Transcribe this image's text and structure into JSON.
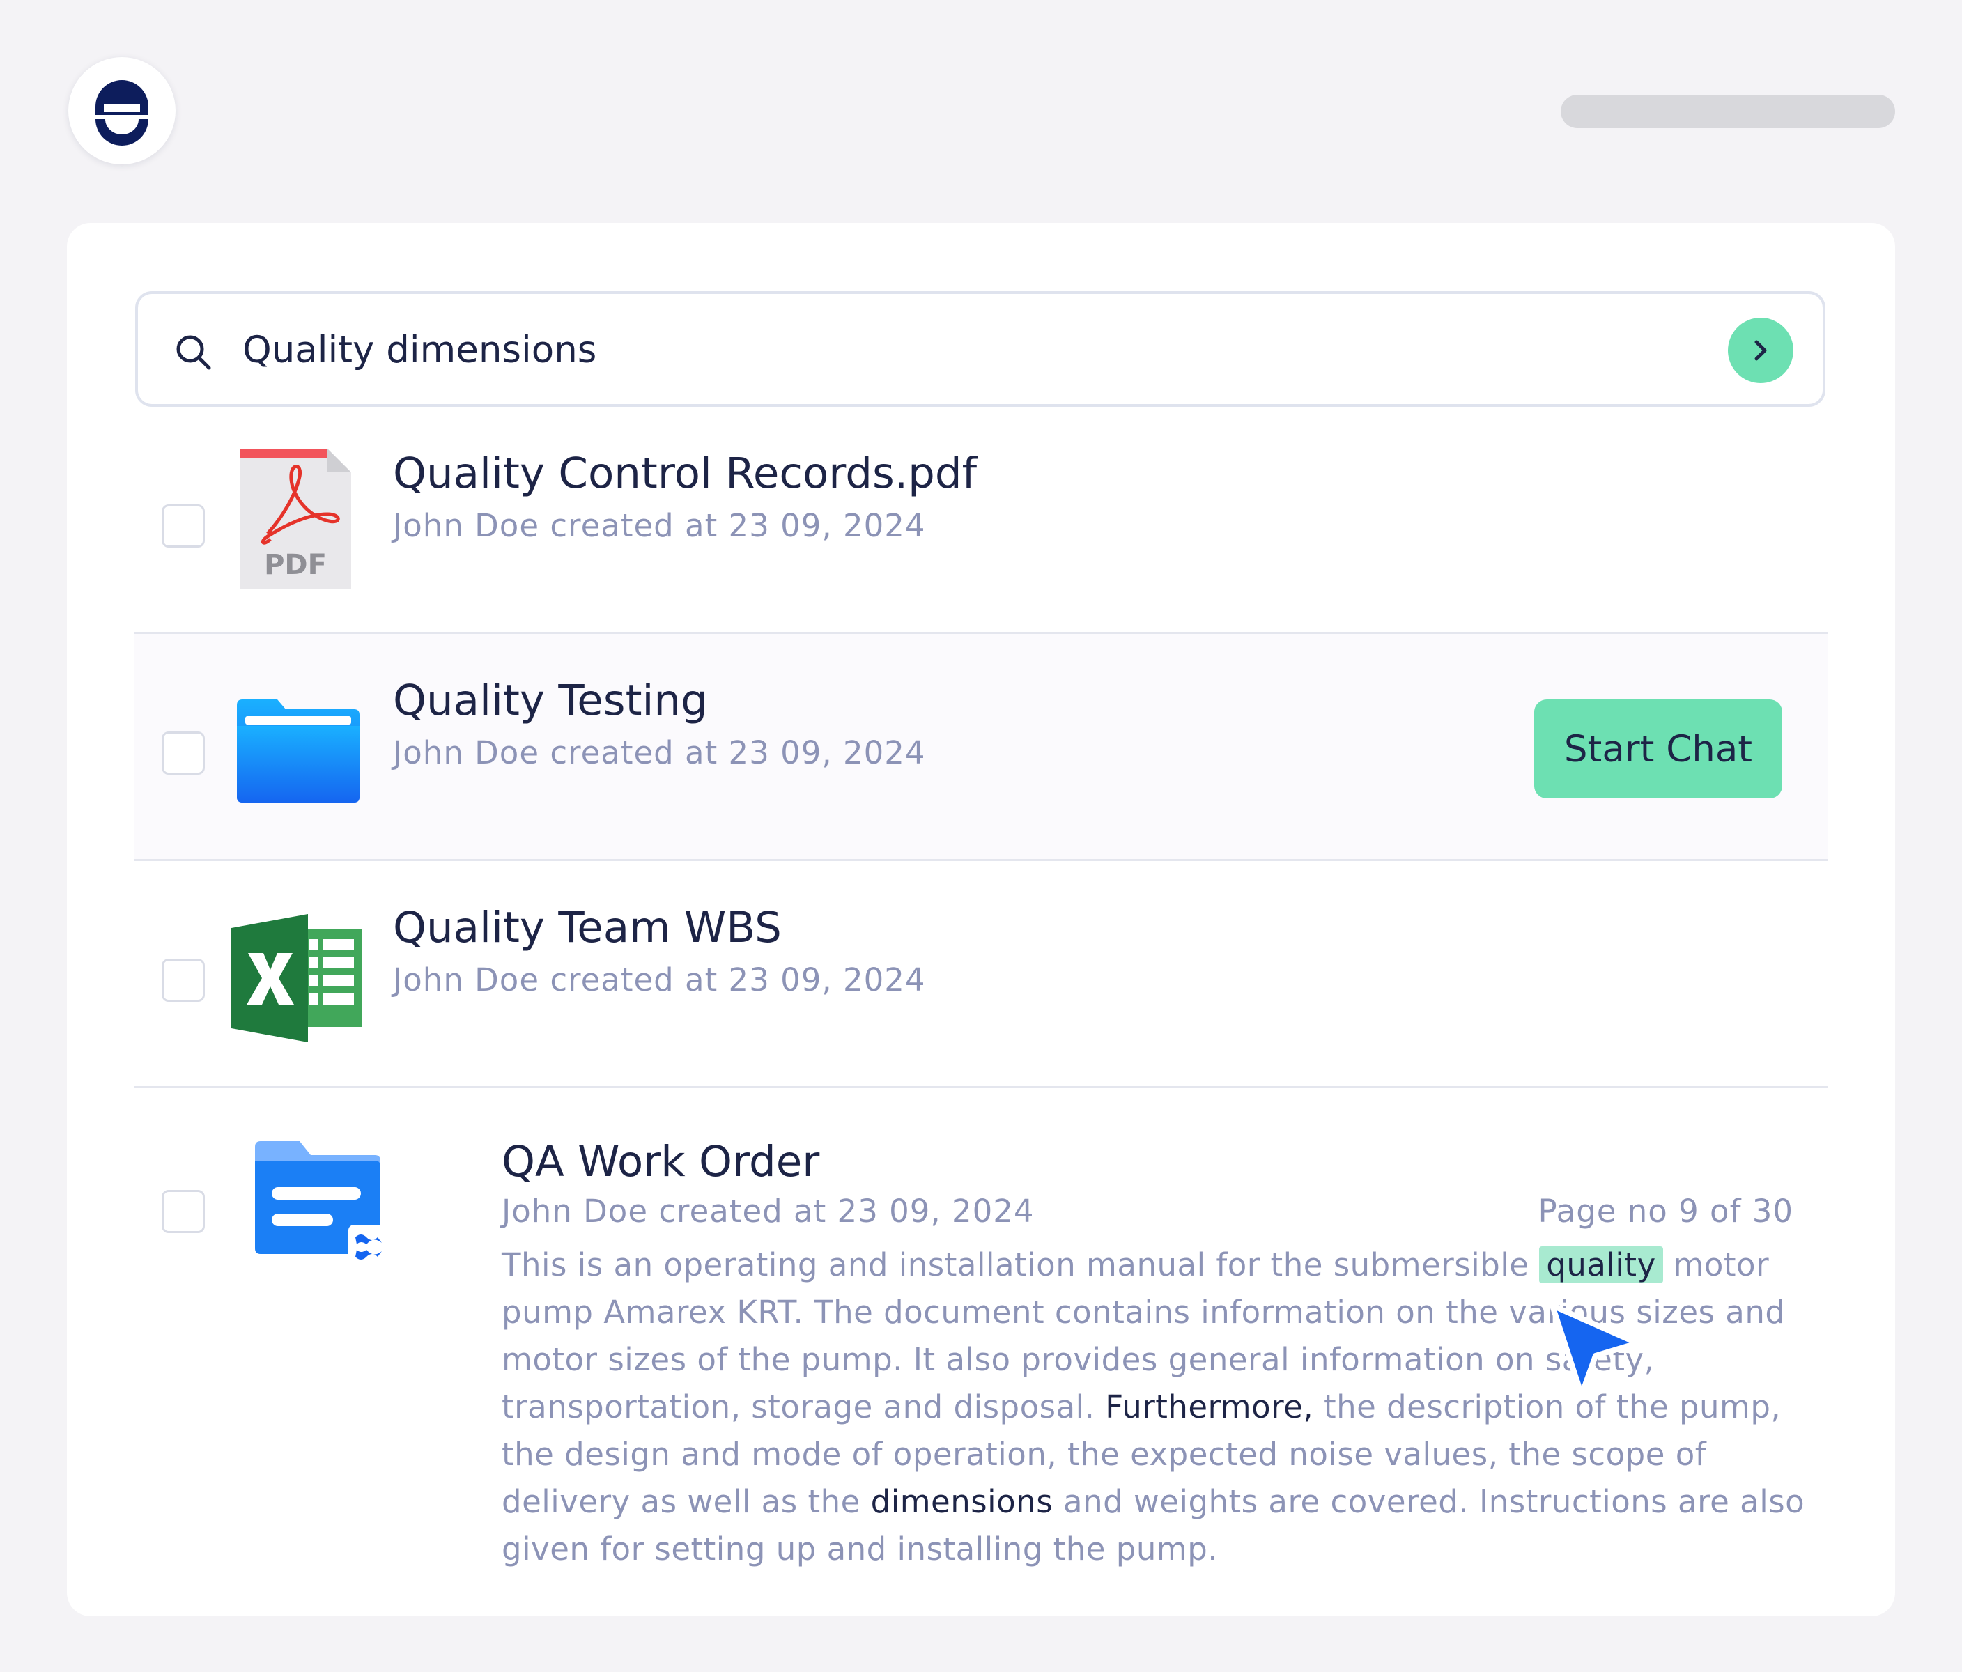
{
  "search": {
    "query": "Quality dimensions",
    "submit_icon": "chevron-right-icon"
  },
  "colors": {
    "accent": "#6de0b2",
    "text": "#1d2446",
    "muted": "#8c93b6",
    "border": "#dfe3ee"
  },
  "results": [
    {
      "type": "pdf",
      "icon": "pdf-file-icon",
      "pdf_label": "PDF",
      "title": "Quality Control Records.pdf",
      "meta": "John Doe created at 23 09, 2024"
    },
    {
      "type": "folder",
      "icon": "folder-icon",
      "title": "Quality Testing",
      "meta": "John Doe created at 23 09, 2024",
      "action_label": "Start Chat"
    },
    {
      "type": "excel",
      "icon": "excel-icon",
      "title": "Quality Team WBS",
      "meta": "John Doe created at 23 09, 2024"
    },
    {
      "type": "confluence",
      "icon": "confluence-folder-icon",
      "title": "QA Work Order",
      "meta": "John Doe created at 23 09, 2024",
      "page_info": "Page no 9 of 30",
      "snippet": {
        "part1": "This is an operating and installation manual for the submersible ",
        "hit1": "quality",
        "part2": " motor pump Amarex KRT. The document contains information on the various sizes and motor sizes of the pump. It also provides general information on safety, transportation, storage and disposal. ",
        "kw1": "Furthermore,",
        "part3": " the description of the pump, the design and mode of operation, the expected noise values, the scope of delivery as well as the ",
        "kw2": "dimensions",
        "part4": " and weights are covered. Instructions are also given for setting up and installing the pump."
      }
    }
  ]
}
